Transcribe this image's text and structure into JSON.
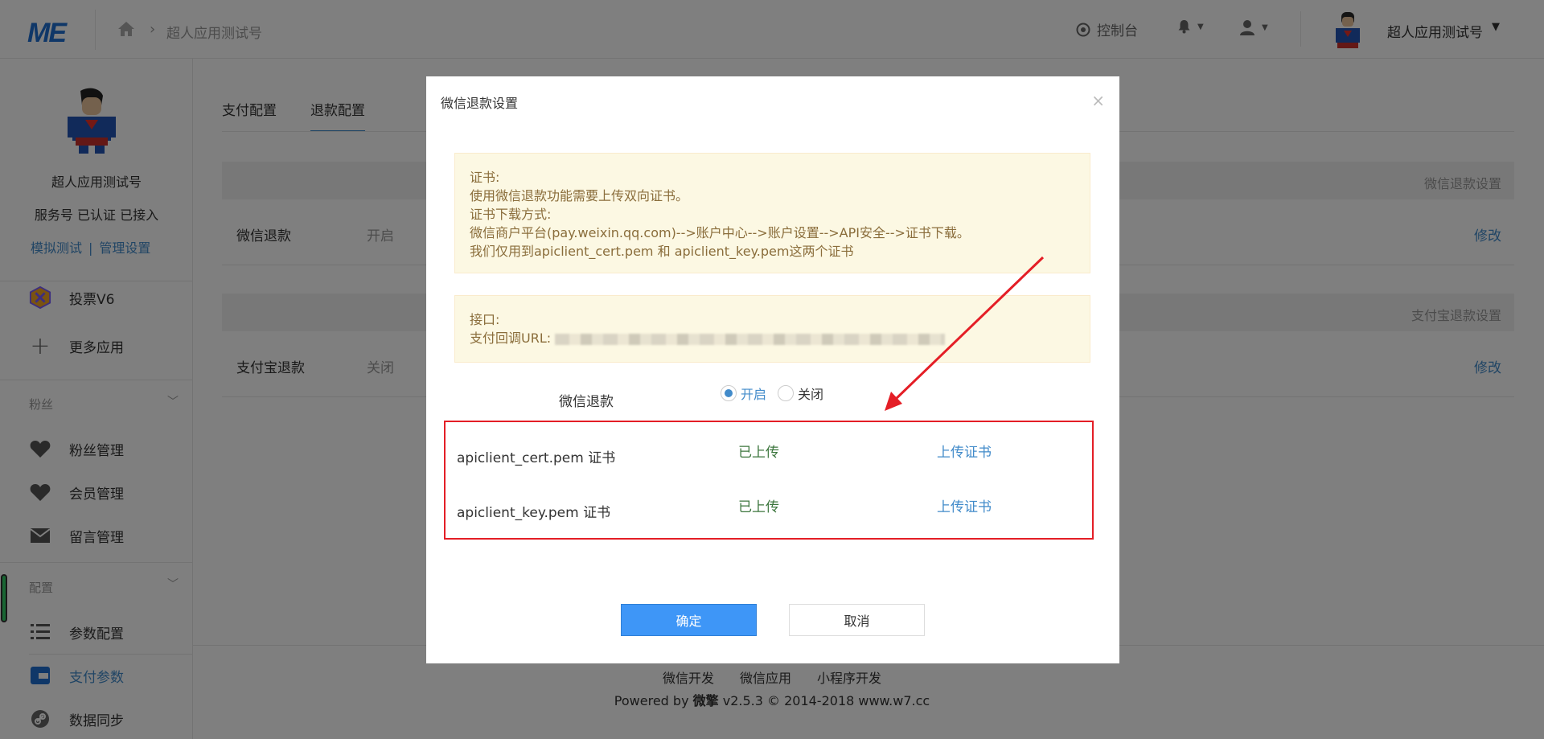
{
  "topbar": {
    "logo": "ME",
    "breadcrumb": "超人应用测试号",
    "console_label": "控制台",
    "user_name": "超人应用测试号"
  },
  "sidebar": {
    "account_name": "超人应用测试号",
    "account_status": "服务号 已认证 已接入",
    "link_test": "模拟测试",
    "link_sep": "|",
    "link_manage": "管理设置",
    "apps": [
      {
        "label": "投票V6"
      },
      {
        "label": "更多应用"
      }
    ],
    "section_fans": "粉丝",
    "fans_items": [
      {
        "label": "粉丝管理"
      },
      {
        "label": "会员管理"
      },
      {
        "label": "留言管理"
      }
    ],
    "section_config": "配置",
    "config_items": [
      {
        "label": "参数配置"
      },
      {
        "label": "支付参数"
      },
      {
        "label": "数据同步"
      }
    ]
  },
  "main": {
    "tabs": [
      {
        "label": "支付配置"
      },
      {
        "label": "退款配置"
      }
    ],
    "panels": [
      {
        "header": "微信退款设置",
        "key": "微信退款",
        "value": "开启",
        "edit": "修改"
      },
      {
        "header": "支付宝退款设置",
        "key": "支付宝退款",
        "value": "关闭",
        "edit": "修改"
      }
    ]
  },
  "footer": {
    "links": [
      "微信开发",
      "微信应用",
      "小程序开发"
    ],
    "powered_prefix": "Powered by",
    "brand": "微擎",
    "powered_suffix": "v2.5.3 © 2014-2018 www.w7.cc"
  },
  "modal": {
    "title": "微信退款设置",
    "close": "×",
    "notice1": {
      "line1": "证书:",
      "line2": "使用微信退款功能需要上传双向证书。",
      "line3": "证书下载方式:",
      "line4": "微信商户平台(pay.weixin.qq.com)-->账户中心-->账户设置-->API安全-->证书下载。",
      "line5": "我们仅用到apiclient_cert.pem 和 apiclient_key.pem这两个证书"
    },
    "notice2": {
      "line1": "接口:",
      "line2_label": "支付回调URL:"
    },
    "radio_label": "微信退款",
    "radio_on": "开启",
    "radio_off": "关闭",
    "certs": [
      {
        "name": "apiclient_cert.pem 证书",
        "state": "已上传",
        "action": "上传证书"
      },
      {
        "name": "apiclient_key.pem 证书",
        "state": "已上传",
        "action": "上传证书"
      }
    ],
    "ok": "确定",
    "cancel": "取消"
  },
  "colors": {
    "accent": "#428bca",
    "primary_button": "#3e96f7",
    "highlight_red": "#e41e26",
    "success_green": "#3c763d",
    "notice_bg": "#fcf8e3"
  }
}
